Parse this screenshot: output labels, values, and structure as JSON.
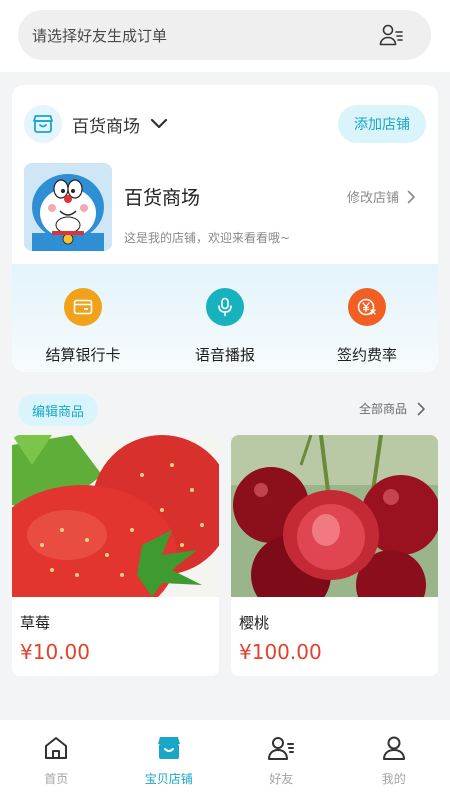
{
  "search": {
    "placeholder": "请选择好友生成订单",
    "icon": "friend-list-icon"
  },
  "store": {
    "name_dropdown": "百货商场",
    "add_store_label": "添加店铺",
    "title": "百货商场",
    "description": "这是我的店铺，欢迎来看看哦~",
    "edit_label": "修改店铺",
    "accent_color": "#1aa6c7"
  },
  "services": [
    {
      "label": "结算银行卡",
      "icon": "bank-card-icon",
      "color": "#f0a21b"
    },
    {
      "label": "语音播报",
      "icon": "microphone-icon",
      "color": "#17b2bd"
    },
    {
      "label": "签约费率",
      "icon": "yen-rate-icon",
      "color": "#f05f24"
    }
  ],
  "products_section": {
    "edit_label": "编辑商品",
    "all_label": "全部商品"
  },
  "products": [
    {
      "name": "草莓",
      "price": "¥10.00"
    },
    {
      "name": "樱桃",
      "price": "¥100.00"
    }
  ],
  "tabs": [
    {
      "label": "首页",
      "icon": "home-icon",
      "active": false
    },
    {
      "label": "宝贝店铺",
      "icon": "store-icon",
      "active": true
    },
    {
      "label": "好友",
      "icon": "friends-icon",
      "active": false
    },
    {
      "label": "我的",
      "icon": "user-icon",
      "active": false
    }
  ]
}
